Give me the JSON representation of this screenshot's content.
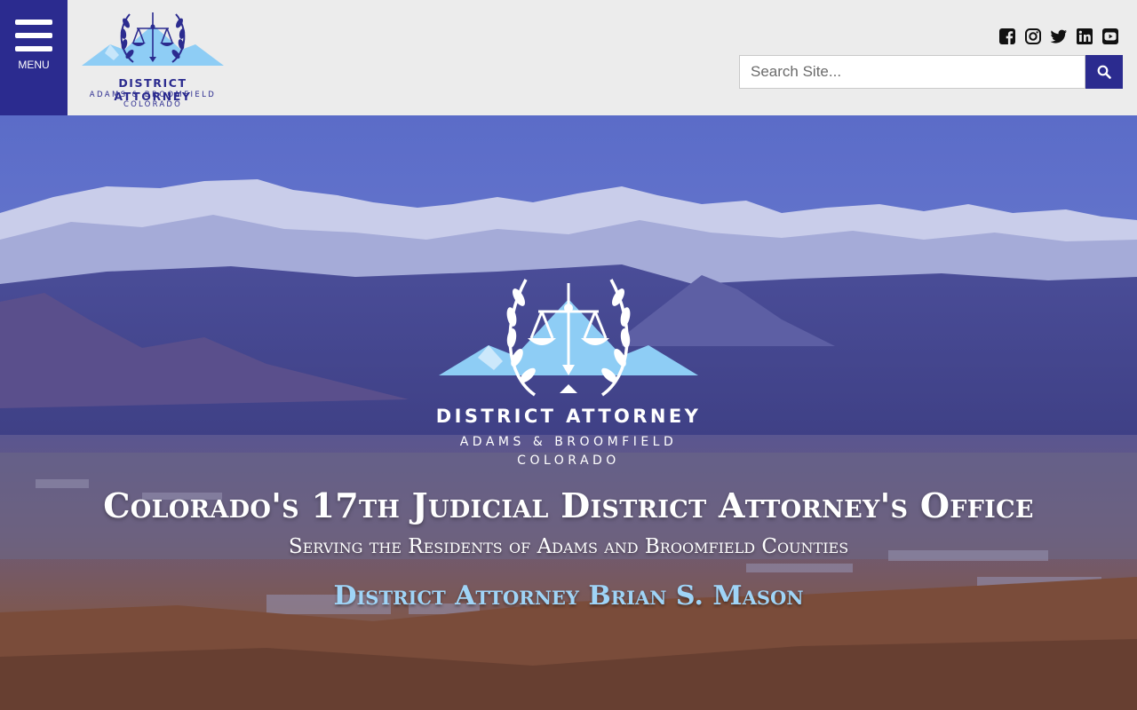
{
  "header": {
    "menu_label": "MENU",
    "logo": {
      "title": "DISTRICT ATTORNEY",
      "subtitle": "ADAMS & BROOMFIELD",
      "subtitle2": "COLORADO"
    },
    "social_icons": [
      "facebook-square-icon",
      "instagram-icon",
      "twitter-icon",
      "linkedin-icon",
      "youtube-icon"
    ],
    "search": {
      "placeholder": "Search Site...",
      "value": "",
      "button_icon": "search-icon"
    }
  },
  "hero": {
    "logo": {
      "title": "DISTRICT ATTORNEY",
      "subtitle": "ADAMS & BROOMFIELD",
      "subtitle2": "COLORADO"
    },
    "title": "Colorado's 17th Judicial District Attorney's Office",
    "subtitle": "Serving the Residents of Adams and Broomfield Counties",
    "da_name": "District Attorney Brian S. Mason"
  },
  "colors": {
    "brand_navy": "#2b2b8f",
    "header_bg": "#ececec",
    "accent_light_blue": "#9fd4f7",
    "mountain_blue": "#8ecdf5"
  }
}
